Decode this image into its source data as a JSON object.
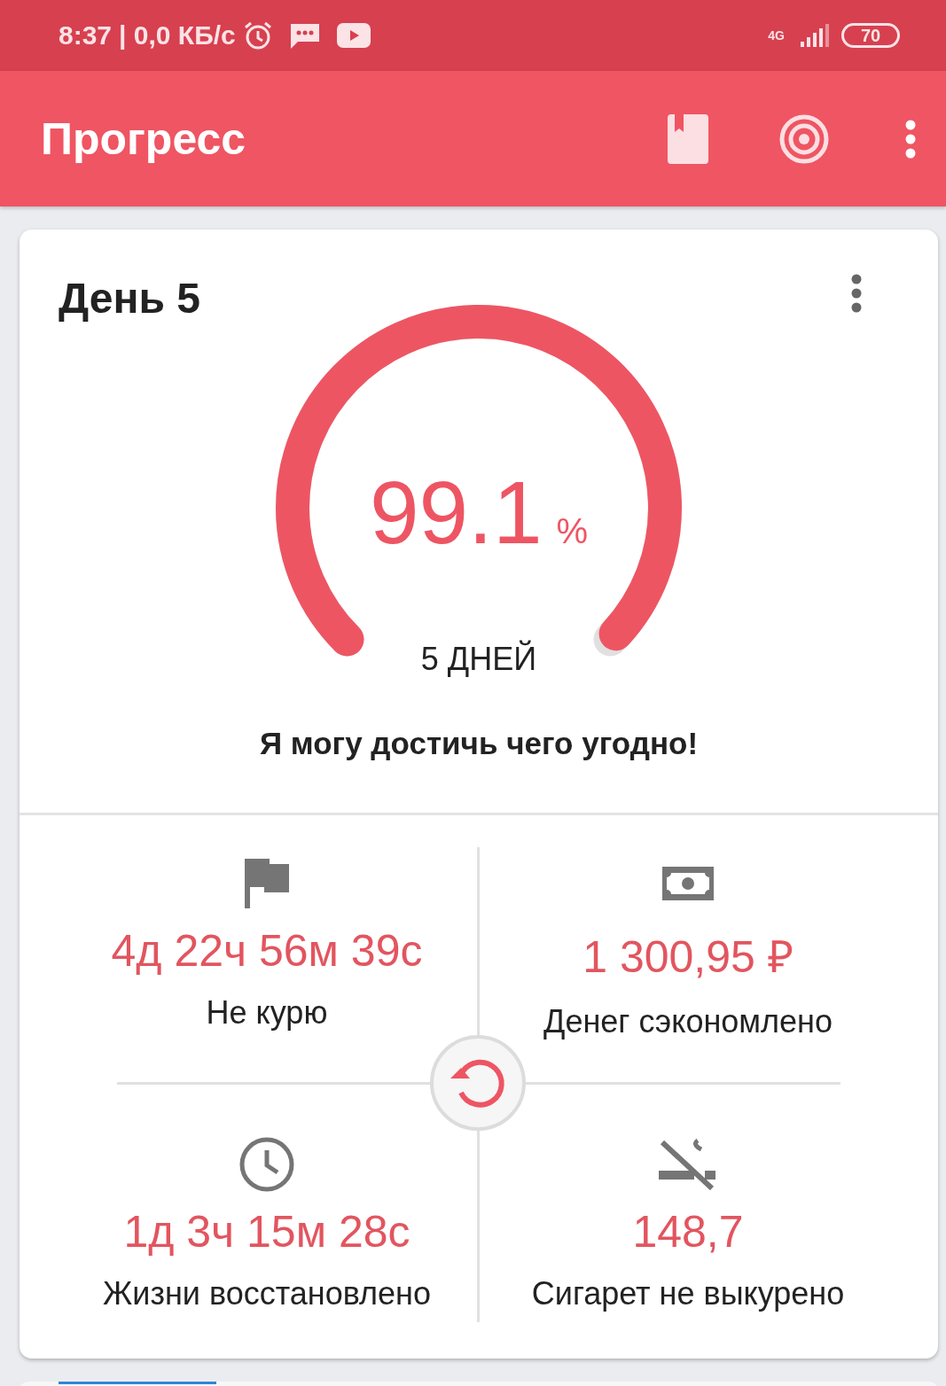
{
  "status_bar": {
    "time": "8:37",
    "speed": "| 0,0 КБ/с",
    "network": "4G",
    "battery": "70"
  },
  "app_bar": {
    "title": "Прогресс"
  },
  "card": {
    "title": "День 5",
    "percent": "99.1",
    "percent_sign": "%",
    "days": "5 ДНЕЙ",
    "quote": "Я могу достичь чего угодно!",
    "stats": [
      {
        "kind": "flag",
        "value": "4д 22ч 56м 39с",
        "label": "Не курю"
      },
      {
        "kind": "money",
        "value": "1 300,95 ₽",
        "label": "Денег сэкономлено"
      },
      {
        "kind": "clock",
        "value": "1д 3ч 15м 28с",
        "label": "Жизни восстановлено"
      },
      {
        "kind": "no-smoking",
        "value": "148,7",
        "label": "Сигарет не выкурено"
      }
    ]
  }
}
